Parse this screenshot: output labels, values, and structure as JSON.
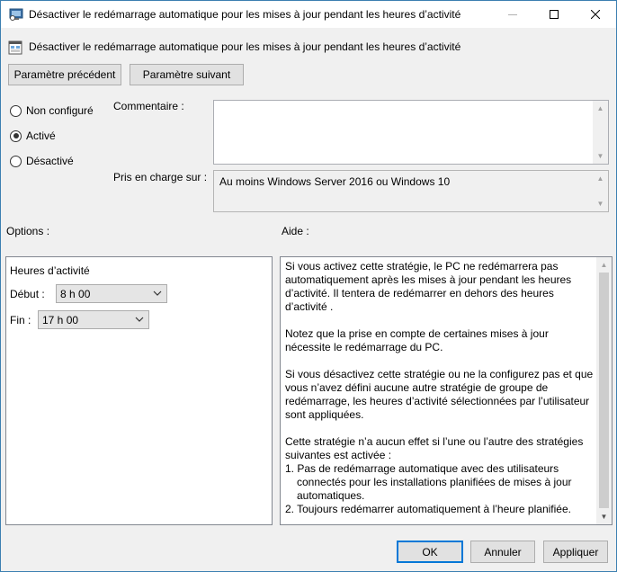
{
  "window": {
    "title": "Désactiver le redémarrage automatique pour les mises à jour pendant les heures d’activité"
  },
  "header": {
    "title": "Désactiver le redémarrage automatique pour les mises à jour pendant les heures d’activité"
  },
  "nav": {
    "previous_label": "Paramètre précédent",
    "next_label": "Paramètre suivant"
  },
  "state": {
    "options": [
      {
        "label": "Non configuré",
        "checked": false
      },
      {
        "label": "Activé",
        "checked": true
      },
      {
        "label": "Désactivé",
        "checked": false
      }
    ]
  },
  "comment": {
    "label": "Commentaire :",
    "value": ""
  },
  "supported": {
    "label": "Pris en charge sur :",
    "value": "Au moins Windows Server 2016 ou Windows 10"
  },
  "options_section": {
    "label": "Options :",
    "heading": "Heures d’activité",
    "start_label": "Début :",
    "start_value": "8 h 00",
    "end_label": "Fin :",
    "end_value": "17 h 00"
  },
  "help_section": {
    "label": "Aide :",
    "paragraphs": [
      "Si vous activez cette stratégie, le PC ne redémarrera pas automatiquement après les mises à jour pendant les heures d’activité. Il tentera de redémarrer en dehors des heures d’activité .",
      "Notez que la prise en compte de certaines mises à jour nécessite le redémarrage du PC.",
      "Si vous désactivez cette stratégie ou ne la configurez pas et que vous n’avez défini aucune autre stratégie de groupe de redémarrage, les heures d’activité sélectionnées par l’utilisateur sont appliquées.",
      "Cette stratégie n’a aucun effet si l’une ou l’autre des stratégies suivantes est activée :"
    ],
    "list_items": [
      "1. Pas de redémarrage automatique avec des utilisateurs connectés pour les installations planifiées de mises à jour automatiques.",
      "2. Toujours redémarrer automatiquement à l’heure planifiée."
    ]
  },
  "footer": {
    "ok_label": "OK",
    "cancel_label": "Annuler",
    "apply_label": "Appliquer"
  },
  "colors": {
    "accent": "#0078d7",
    "window_bg": "#f0f0f0",
    "button_bg": "#e1e1e1"
  }
}
